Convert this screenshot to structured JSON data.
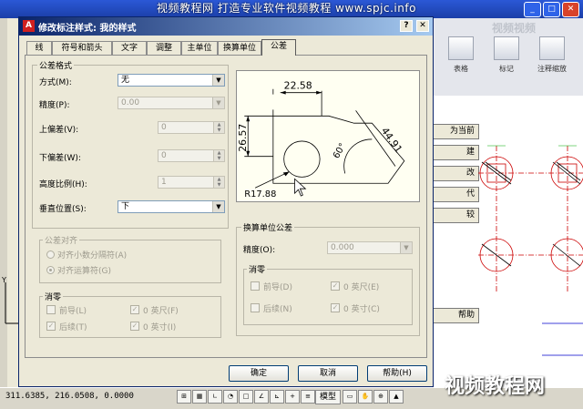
{
  "watermark": {
    "top": "视频教程网  打造专业软件视频教程      www.spjc.info",
    "ribbon": "视频视频",
    "bottom_url": "www.spjc.info",
    "bottom_cn": "视频教程网"
  },
  "ribbon": {
    "items": [
      "表格",
      "标记",
      "注释缩放"
    ]
  },
  "side_buttons": [
    "为当前",
    "建",
    "改",
    "代",
    "较",
    "帮助"
  ],
  "statusbar": {
    "coords": "311.6385, 216.0508, 0.0000",
    "model": "模型"
  },
  "dialog": {
    "title": "修改标注样式: 我的样式",
    "tabs": [
      "线",
      "符号和箭头",
      "文字",
      "调整",
      "主单位",
      "换算单位",
      "公差"
    ],
    "active_tab": "公差",
    "tolerance_format": {
      "title": "公差格式",
      "method_label": "方式(M):",
      "method_value": "无",
      "precision_label": "精度(P):",
      "precision_value": "0.00",
      "upper_label": "上偏差(V):",
      "upper_value": "0",
      "lower_label": "下偏差(W):",
      "lower_value": "0",
      "height_label": "高度比例(H):",
      "height_value": "1",
      "vpos_label": "垂直位置(S):",
      "vpos_value": "下"
    },
    "alignment": {
      "title": "公差对齐",
      "opt1": "对齐小数分隔符(A)",
      "opt2": "对齐运算符(G)",
      "selected": "opt2"
    },
    "zero_left": {
      "title": "消零",
      "leading": "前导(L)",
      "trailing": "后续(T)",
      "feet": "0 英尺(F)",
      "inches": "0 英寸(I)",
      "leading_checked": false,
      "trailing_checked": true,
      "feet_checked": true,
      "inches_checked": true
    },
    "alt_tolerance": {
      "title": "换算单位公差",
      "precision_label": "精度(O):",
      "precision_value": "0.000"
    },
    "zero_right": {
      "title": "消零",
      "leading": "前导(D)",
      "trailing": "后续(N)",
      "feet": "0 英尺(E)",
      "inches": "0 英寸(C)",
      "leading_checked": false,
      "trailing_checked": false,
      "feet_checked": true,
      "inches_checked": true
    },
    "preview": {
      "dim_top": "22.58",
      "dim_left": "26.57",
      "dim_diag": "44.91",
      "angle": "60°",
      "radius": "R17.88"
    },
    "buttons": {
      "ok": "确定",
      "cancel": "取消",
      "help": "帮助(H)"
    }
  },
  "colors": {
    "titlebar": "#0a246a",
    "dialog_bg": "#ece9d8",
    "preview_bg": "#fffff2"
  }
}
